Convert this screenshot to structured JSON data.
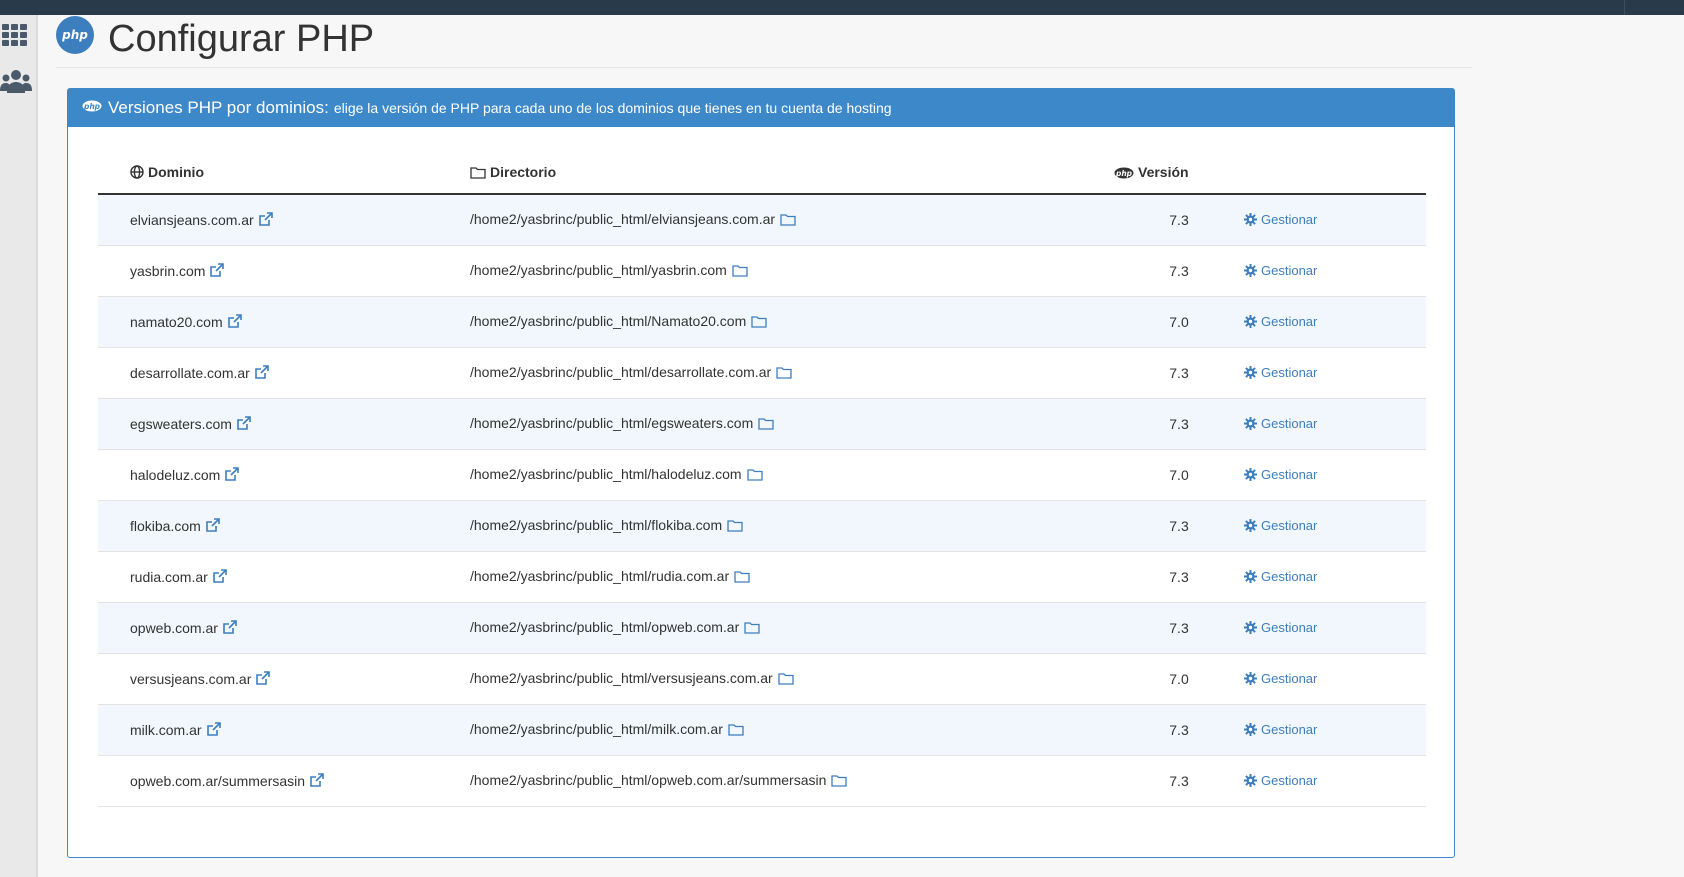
{
  "page": {
    "title": "Configurar PHP",
    "logo_text": "php"
  },
  "panel": {
    "title": "Versiones PHP por dominios:",
    "subtitle": "elige la versión de PHP para cada uno de los dominios que tienes en tu cuenta de hosting"
  },
  "table": {
    "headers": {
      "domain": "Dominio",
      "directory": "Directorio",
      "version": "Versión"
    },
    "action_label": "Gestionar",
    "rows": [
      {
        "domain": "elviansjeans.com.ar",
        "directory": "/home2/yasbrinc/public_html/elviansjeans.com.ar",
        "version": "7.3"
      },
      {
        "domain": "yasbrin.com",
        "directory": "/home2/yasbrinc/public_html/yasbrin.com",
        "version": "7.3"
      },
      {
        "domain": "namato20.com",
        "directory": "/home2/yasbrinc/public_html/Namato20.com",
        "version": "7.0"
      },
      {
        "domain": "desarrollate.com.ar",
        "directory": "/home2/yasbrinc/public_html/desarrollate.com.ar",
        "version": "7.3"
      },
      {
        "domain": "egsweaters.com",
        "directory": "/home2/yasbrinc/public_html/egsweaters.com",
        "version": "7.3"
      },
      {
        "domain": "halodeluz.com",
        "directory": "/home2/yasbrinc/public_html/halodeluz.com",
        "version": "7.0"
      },
      {
        "domain": "flokiba.com",
        "directory": "/home2/yasbrinc/public_html/flokiba.com",
        "version": "7.3"
      },
      {
        "domain": "rudia.com.ar",
        "directory": "/home2/yasbrinc/public_html/rudia.com.ar",
        "version": "7.3"
      },
      {
        "domain": "opweb.com.ar",
        "directory": "/home2/yasbrinc/public_html/opweb.com.ar",
        "version": "7.3"
      },
      {
        "domain": "versusjeans.com.ar",
        "directory": "/home2/yasbrinc/public_html/versusjeans.com.ar",
        "version": "7.0"
      },
      {
        "domain": "milk.com.ar",
        "directory": "/home2/yasbrinc/public_html/milk.com.ar",
        "version": "7.3"
      },
      {
        "domain": "opweb.com.ar/summersasin",
        "directory": "/home2/yasbrinc/public_html/opweb.com.ar/summersasin",
        "version": "7.3"
      }
    ]
  },
  "sidebar": {
    "icons": [
      "apps-grid-icon",
      "users-icon"
    ]
  },
  "colors": {
    "topbar": "#293a4a",
    "primary": "#3d88c8",
    "link": "#3d7ebf",
    "row_stripe": "#f1f7fc"
  }
}
